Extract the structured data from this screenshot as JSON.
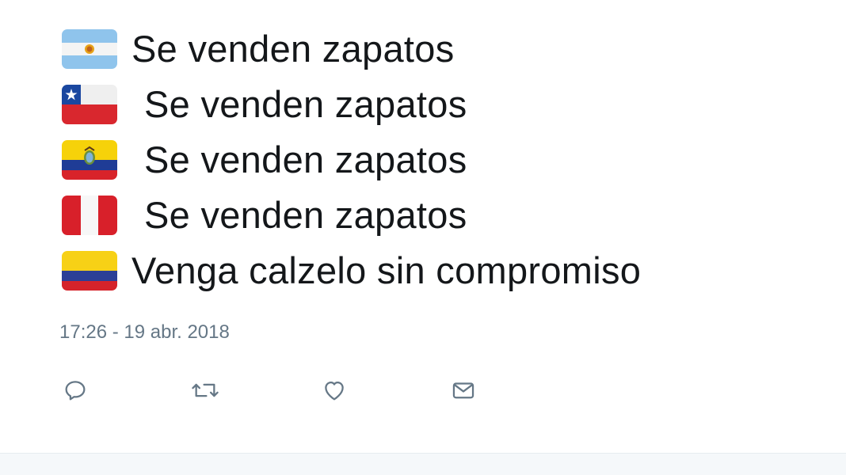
{
  "tweet": {
    "lines": [
      {
        "flag": "argentina-flag",
        "text": "Se venden zapatos"
      },
      {
        "flag": "chile-flag",
        "text": "Se venden zapatos"
      },
      {
        "flag": "ecuador-flag",
        "text": "Se venden zapatos"
      },
      {
        "flag": "peru-flag",
        "text": "Se venden zapatos"
      },
      {
        "flag": "colombia-flag",
        "text": "Venga calzelo sin compromiso"
      }
    ],
    "timestamp": "17:26 - 19 abr. 2018"
  },
  "actions": {
    "reply_icon": "reply-icon",
    "retweet_icon": "retweet-icon",
    "like_icon": "heart-icon",
    "message_icon": "envelope-icon"
  },
  "colors": {
    "text": "#14171a",
    "secondary": "#657786",
    "footer_background": "#f5f8fa"
  }
}
